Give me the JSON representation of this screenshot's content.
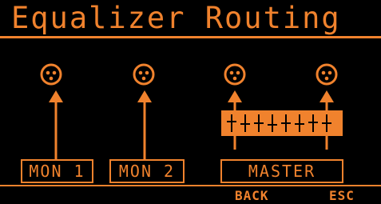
{
  "title": "Equalizer Routing",
  "outputs": [
    {
      "label": "MON 1"
    },
    {
      "label": "MON 2"
    },
    {
      "label": "MASTER"
    }
  ],
  "softkeys": {
    "back": "BACK",
    "esc": "ESC"
  },
  "icons": [
    "xlr-connector-icon",
    "arrow-up-icon",
    "graphic-eq-icon"
  ],
  "colors": {
    "accent": "#f0822d",
    "background": "#000000"
  }
}
